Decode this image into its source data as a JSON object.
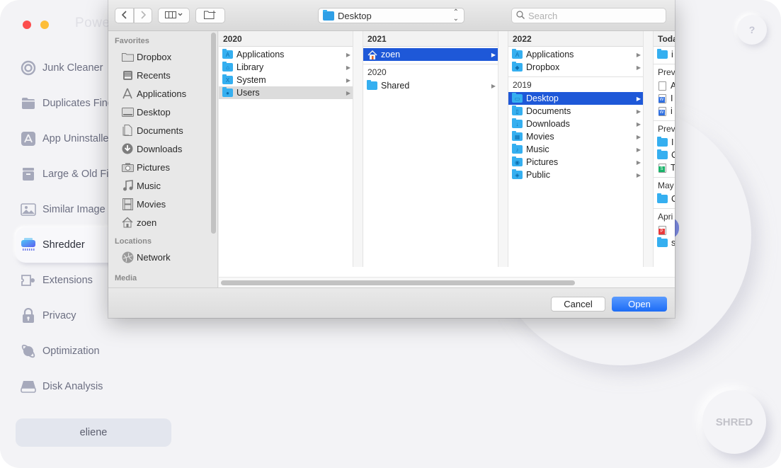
{
  "app": {
    "title": "PowerSuite",
    "title_visible": "Powe",
    "help_label": "?",
    "shred_label": "SHRED",
    "user_label": "eliene",
    "sidebar": [
      {
        "label": "Junk Cleaner",
        "icon": "junk-cleaner-icon",
        "active": false
      },
      {
        "label": "Duplicates Finder",
        "icon": "folder-icon",
        "active": false
      },
      {
        "label": "App Uninstaller",
        "icon": "app-store-icon",
        "active": false
      },
      {
        "label": "Large & Old Files",
        "icon": "box-icon",
        "active": false
      },
      {
        "label": "Similar Image Finder",
        "icon": "image-icon",
        "active": false
      },
      {
        "label": "Shredder",
        "icon": "shredder-icon",
        "active": true
      },
      {
        "label": "Extensions",
        "icon": "extension-icon",
        "active": false
      },
      {
        "label": "Privacy",
        "icon": "lock-icon",
        "active": false
      },
      {
        "label": "Optimization",
        "icon": "planet-icon",
        "active": false
      },
      {
        "label": "Disk Analysis",
        "icon": "disk-icon",
        "active": false
      }
    ]
  },
  "dialog": {
    "path_popup": "Desktop",
    "search_placeholder": "Search",
    "sidebar": {
      "favorites_header": "Favorites",
      "favorites": [
        {
          "label": "Dropbox",
          "icon": "folder-icon"
        },
        {
          "label": "Recents",
          "icon": "recents-icon"
        },
        {
          "label": "Applications",
          "icon": "applications-icon"
        },
        {
          "label": "Desktop",
          "icon": "desktop-icon"
        },
        {
          "label": "Documents",
          "icon": "documents-icon"
        },
        {
          "label": "Downloads",
          "icon": "downloads-icon"
        },
        {
          "label": "Pictures",
          "icon": "camera-icon"
        },
        {
          "label": "Music",
          "icon": "music-icon"
        },
        {
          "label": "Movies",
          "icon": "film-icon"
        },
        {
          "label": "zoen",
          "icon": "home-icon"
        }
      ],
      "locations_header": "Locations",
      "locations": [
        {
          "label": "Network",
          "icon": "network-icon"
        }
      ],
      "media_header": "Media"
    },
    "columns": [
      {
        "groups": [
          {
            "header": "2020",
            "items": [
              {
                "label": "Applications",
                "glyph": "A",
                "selected": false
              },
              {
                "label": "Library",
                "glyph": "⌂",
                "selected": false
              },
              {
                "label": "System",
                "glyph": "X",
                "selected": false
              },
              {
                "label": "Users",
                "glyph": "●",
                "selected": "gray"
              }
            ]
          }
        ]
      },
      {
        "groups": [
          {
            "header": "2021",
            "items": [
              {
                "label": "zoen",
                "glyph": "home",
                "selected": "blue"
              }
            ]
          },
          {
            "header": "2020",
            "items": [
              {
                "label": "Shared",
                "glyph": "",
                "selected": false
              }
            ]
          }
        ]
      },
      {
        "groups": [
          {
            "header": "2022",
            "items": [
              {
                "label": "Applications",
                "glyph": "A",
                "selected": false
              },
              {
                "label": "Dropbox",
                "glyph": "◆",
                "selected": false
              }
            ]
          },
          {
            "header": "2019",
            "items": [
              {
                "label": "Desktop",
                "glyph": "▭",
                "selected": "blue"
              },
              {
                "label": "Documents",
                "glyph": "▯",
                "selected": false
              },
              {
                "label": "Downloads",
                "glyph": "↓",
                "selected": false
              },
              {
                "label": "Movies",
                "glyph": "▦",
                "selected": false
              },
              {
                "label": "Music",
                "glyph": "♪",
                "selected": false
              },
              {
                "label": "Pictures",
                "glyph": "◉",
                "selected": false
              },
              {
                "label": "Public",
                "glyph": "◈",
                "selected": false
              }
            ]
          }
        ]
      }
    ],
    "preview_column": {
      "groups": [
        {
          "header": "Toda",
          "items": [
            {
              "type": "folder",
              "label": "i"
            }
          ]
        },
        {
          "header": "Prev",
          "items": [
            {
              "type": "generic",
              "label": "A"
            },
            {
              "type": "word",
              "label": "I"
            },
            {
              "type": "word",
              "label": "i"
            }
          ]
        },
        {
          "header": "Prev",
          "items": [
            {
              "type": "folder",
              "label": "I"
            },
            {
              "type": "folder",
              "label": "C"
            },
            {
              "type": "sheet",
              "label": "T"
            }
          ]
        },
        {
          "header": "May",
          "items": [
            {
              "type": "folder",
              "label": "C"
            }
          ]
        },
        {
          "header": "Apri",
          "items": [
            {
              "type": "pdf",
              "label": ""
            },
            {
              "type": "folder",
              "label": "s"
            }
          ]
        }
      ]
    },
    "cancel_label": "Cancel",
    "open_label": "Open"
  },
  "colors": {
    "selection_blue": "#1e58d8",
    "open_button": "#1c6cf6",
    "folder_blue": "#35aff0"
  }
}
